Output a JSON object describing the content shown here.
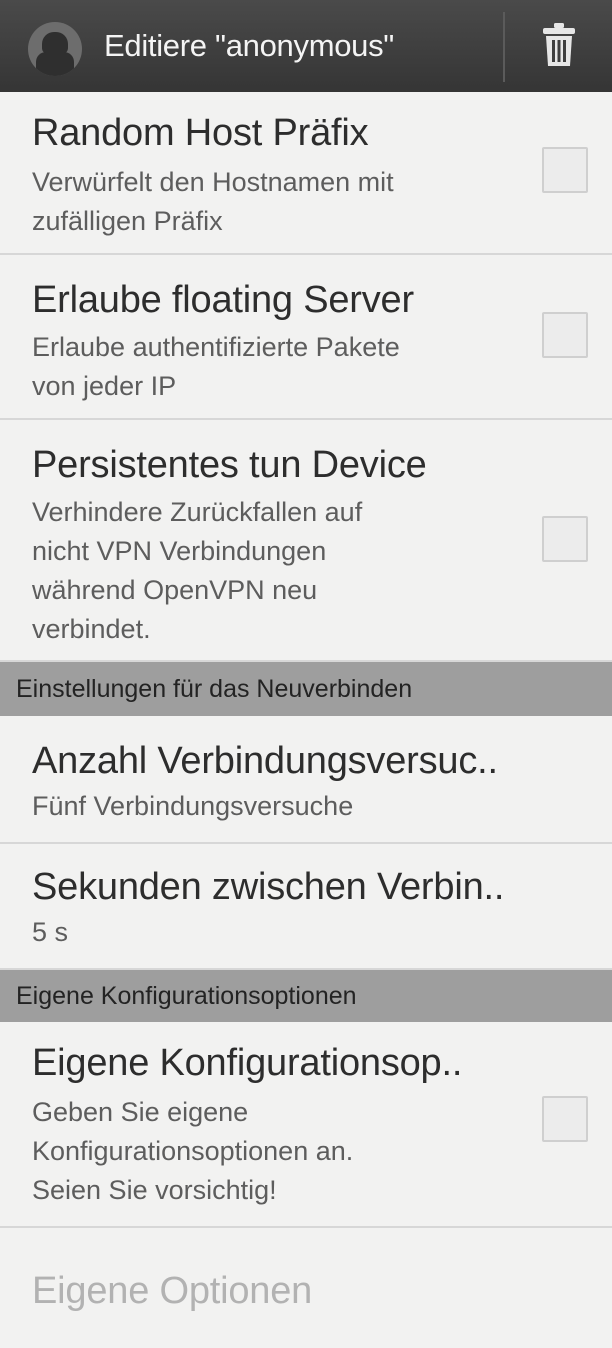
{
  "header": {
    "title": "Editiere \"anonymous\"",
    "app_icon": "android-user-icon",
    "delete_icon": "trash-icon"
  },
  "items": [
    {
      "title": "Random Host Präfix",
      "summary_lines": [
        "Verwürfelt den Hostnamen mit",
        "zufälligen Präfix"
      ],
      "checked": false
    },
    {
      "title": "Erlaube floating Server",
      "summary_lines": [
        "Erlaube authentifizierte Pakete",
        "von jeder IP"
      ],
      "checked": false
    },
    {
      "title": "Persistentes tun Device",
      "summary_lines": [
        "Verhindere Zurückfallen auf",
        "nicht VPN Verbindungen",
        "während OpenVPN neu",
        "verbindet."
      ],
      "checked": false
    }
  ],
  "sections": {
    "reconnect": {
      "label": "Einstellungen für das Neuverbinden",
      "items": [
        {
          "title": "Anzahl Verbindungsversuc..",
          "summary": "Fünf Verbindungsversuche"
        },
        {
          "title": "Sekunden zwischen Verbin..",
          "summary": "5 s"
        }
      ]
    },
    "custom": {
      "label": "Eigene Konfigurationsoptionen",
      "item": {
        "title": "Eigene Konfigurationsop..",
        "summary_lines": [
          "Geben Sie eigene",
          "Konfigurationsoptionen an.",
          "Seien Sie vorsichtig!"
        ],
        "checked": false
      },
      "disabled_item": {
        "title": "Eigene Optionen"
      }
    }
  },
  "colors": {
    "actionbar": "#3d3d3d",
    "section_header": "#9e9e9e",
    "background": "#f2f2f1",
    "disabled_text": "#b2b2b2"
  }
}
